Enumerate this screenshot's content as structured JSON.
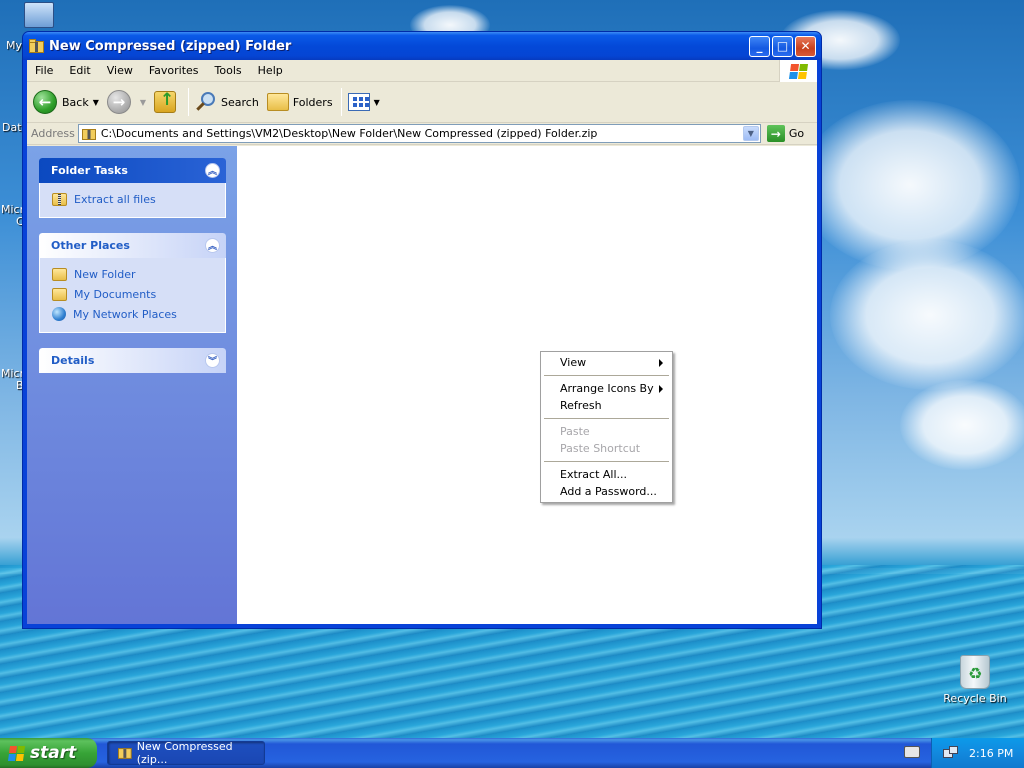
{
  "window": {
    "title": "New Compressed (zipped) Folder",
    "controls": {
      "minimize": "_",
      "maximize": "□",
      "close": "✕"
    }
  },
  "menubar": [
    "File",
    "Edit",
    "View",
    "Favorites",
    "Tools",
    "Help"
  ],
  "toolbar": {
    "back_label": "Back",
    "search_label": "Search",
    "folders_label": "Folders"
  },
  "address": {
    "label": "Address",
    "value": "C:\\Documents and Settings\\VM2\\Desktop\\New Folder\\New Compressed (zipped) Folder.zip",
    "go_label": "Go"
  },
  "taskpane": {
    "folder_tasks": {
      "title": "Folder Tasks",
      "items": [
        "Extract all files"
      ]
    },
    "other_places": {
      "title": "Other Places",
      "items": [
        "New Folder",
        "My Documents",
        "My Network Places"
      ]
    },
    "details": {
      "title": "Details"
    }
  },
  "context_menu": {
    "view": "View",
    "arrange": "Arrange Icons By",
    "refresh": "Refresh",
    "paste": "Paste",
    "paste_shortcut": "Paste Shortcut",
    "extract_all": "Extract All...",
    "add_password": "Add a Password..."
  },
  "desktop": {
    "recycle_bin": "Recycle Bin",
    "edge_labels": [
      "My",
      "Dat",
      "Micro",
      "C",
      "Micro",
      "B"
    ]
  },
  "taskbar": {
    "start_label": "start",
    "task_button": "New Compressed (zip...",
    "clock": "2:16 PM"
  },
  "colors": {
    "titlebar": "#0449d8",
    "taskpane_top": "#7ba2e7",
    "taskpane_bottom": "#6375d6",
    "link": "#215dc6",
    "start_green": "#37a437"
  }
}
